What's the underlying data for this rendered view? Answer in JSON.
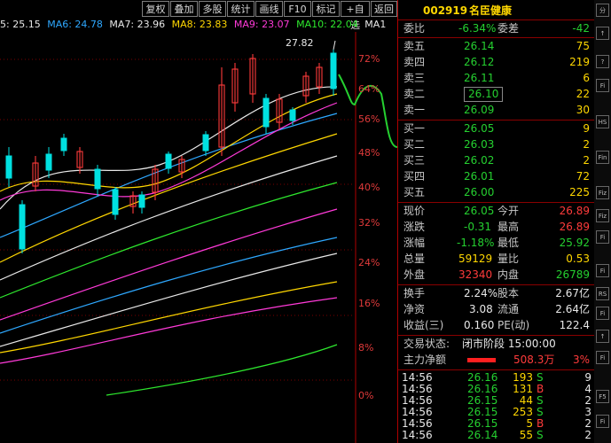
{
  "toolbar": {
    "buttons": [
      "复权",
      "叠加",
      "多股",
      "统计",
      "画线",
      "F10",
      "标记",
      "+自选",
      "返回"
    ]
  },
  "ma_bar": {
    "items": [
      {
        "label": "5: 25.15",
        "color": "#e8e8e8"
      },
      {
        "label": "MA6: 24.78",
        "color": "#2ea8ff"
      },
      {
        "label": "MA7: 23.96",
        "color": "#e8e8e8"
      },
      {
        "label": "MA8: 23.83",
        "color": "#ffd700"
      },
      {
        "label": "MA9: 23.07",
        "color": "#ff3ad8"
      },
      {
        "label": "MA10: 22.04",
        "color": "#2ee82e"
      },
      {
        "label": "MA1",
        "color": "#e8e8e8"
      }
    ]
  },
  "chart": {
    "high_label": "27.82",
    "axis": [
      "72%",
      "64%",
      "56%",
      "48%",
      "40%",
      "32%",
      "24%",
      "16%",
      "8%",
      "0%"
    ]
  },
  "stock": {
    "code": "002919",
    "name": "名臣健康"
  },
  "order_ratio": {
    "label1": "委比",
    "value1": "-6.34%",
    "label2": "委差",
    "value2": "-42"
  },
  "asks": [
    {
      "label": "卖五",
      "price": "26.14",
      "vol": "75"
    },
    {
      "label": "卖四",
      "price": "26.12",
      "vol": "219"
    },
    {
      "label": "卖三",
      "price": "26.11",
      "vol": "6"
    },
    {
      "label": "卖二",
      "price": "26.10",
      "vol": "22"
    },
    {
      "label": "卖一",
      "price": "26.09",
      "vol": "30"
    }
  ],
  "bids": [
    {
      "label": "买一",
      "price": "26.05",
      "vol": "9"
    },
    {
      "label": "买二",
      "price": "26.03",
      "vol": "2"
    },
    {
      "label": "买三",
      "price": "26.02",
      "vol": "2"
    },
    {
      "label": "买四",
      "price": "26.01",
      "vol": "72"
    },
    {
      "label": "买五",
      "price": "26.00",
      "vol": "225"
    }
  ],
  "quote": [
    {
      "l1": "现价",
      "v1": "26.05",
      "c1": "green",
      "l2": "今开",
      "v2": "26.89",
      "c2": "red"
    },
    {
      "l1": "涨跌",
      "v1": "-0.31",
      "c1": "green",
      "l2": "最高",
      "v2": "26.89",
      "c2": "red"
    },
    {
      "l1": "涨幅",
      "v1": "-1.18%",
      "c1": "green",
      "l2": "最低",
      "v2": "25.92",
      "c2": "green"
    },
    {
      "l1": "总量",
      "v1": "59129",
      "c1": "yellow",
      "l2": "量比",
      "v2": "0.53",
      "c2": "yellow"
    },
    {
      "l1": "外盘",
      "v1": "32340",
      "c1": "red",
      "l2": "内盘",
      "v2": "26789",
      "c2": "green"
    }
  ],
  "fundamentals": [
    {
      "l1": "换手",
      "v1": "2.24%",
      "l2": "股本",
      "v2": "2.67亿"
    },
    {
      "l1": "净资",
      "v1": "3.08",
      "l2": "流通",
      "v2": "2.64亿"
    },
    {
      "l1": "收益(三)",
      "v1": "0.160",
      "l2": "PE(动)",
      "v2": "122.4"
    }
  ],
  "trade_status": {
    "label": "交易状态:",
    "value": "闭市阶段 15:00:00"
  },
  "main_flow": {
    "label": "主力净额",
    "value": "508.3万",
    "pct": "3%"
  },
  "ticks": [
    {
      "time": "14:56",
      "price": "26.16",
      "vol": "193",
      "side": "S",
      "n": "9"
    },
    {
      "time": "14:56",
      "price": "26.16",
      "vol": "131",
      "side": "B",
      "n": "4"
    },
    {
      "time": "14:56",
      "price": "26.15",
      "vol": "44",
      "side": "S",
      "n": "2"
    },
    {
      "time": "14:56",
      "price": "26.15",
      "vol": "253",
      "side": "S",
      "n": "3"
    },
    {
      "time": "14:56",
      "price": "26.15",
      "vol": "5",
      "side": "B",
      "n": "2"
    },
    {
      "time": "14:56",
      "price": "26.14",
      "vol": "55",
      "side": "S",
      "n": "2"
    }
  ],
  "side_icons": [
    "分",
    "↑",
    "?",
    "Fi",
    "HS",
    "Fin",
    "Fiz",
    "Fiz",
    "Fi",
    "Fi",
    "RS",
    "Fi",
    "↑",
    "Fi",
    "F5",
    "Fi"
  ]
}
